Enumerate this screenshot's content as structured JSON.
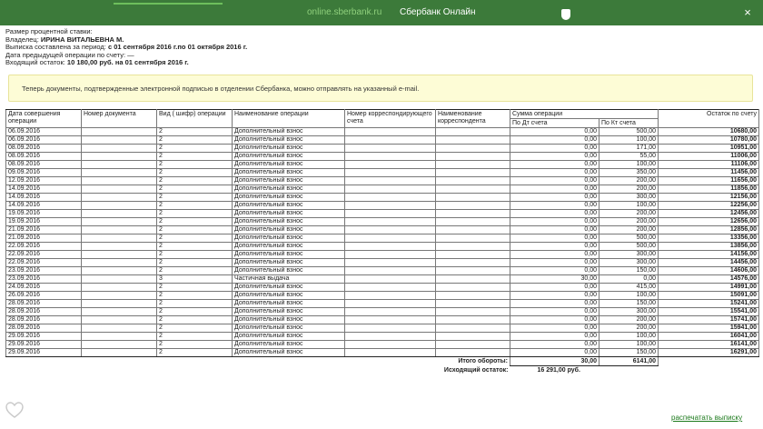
{
  "window": {
    "url": "online.sberbank.ru",
    "title": "Сбербанк Онлайн",
    "close_glyph": "×"
  },
  "info": {
    "rate_label": "Размер процентной ставки:",
    "owner_label": "Владелец:",
    "owner_value": "ИРИНА ВИТАЛЬЕВНА М.",
    "period_label": "Выписка составлена за период:",
    "period_value": "с 01 сентября 2016 г.по 01 октября 2016 г.",
    "prev_op_label": "Дата предыдущей операции по счету:",
    "prev_op_value": "—",
    "balance_label": "Входящий остаток:",
    "balance_value": "10 180,00 руб. на 01 сентября 2016 г."
  },
  "notice": "Теперь документы, подтвержденные электронной подписью в отделении Сбербанка, можно отправлять на указанный e-mail.",
  "table": {
    "headers": {
      "date": "Дата совершения операции",
      "doc": "Номер документа",
      "code": "Вид ( шифр) операции",
      "name": "Наименование операции",
      "corr_acc": "Номер корреспондирующего счета",
      "corr_name": "Наименование корреспондента",
      "amount": "Сумма операции",
      "debit": "По Дт счета",
      "credit": "По Кт счета",
      "balance": "Остаток по счету"
    },
    "rows": [
      [
        "06.09.2016",
        "",
        "2",
        "Дополнительный взнос",
        "",
        "",
        "0,00",
        "500,00",
        "10680,00"
      ],
      [
        "06.09.2016",
        "",
        "2",
        "Дополнительный взнос",
        "",
        "",
        "0,00",
        "100,00",
        "10780,00"
      ],
      [
        "08.09.2016",
        "",
        "2",
        "Дополнительный взнос",
        "",
        "",
        "0,00",
        "171,00",
        "10951,00"
      ],
      [
        "08.09.2016",
        "",
        "2",
        "Дополнительный взнос",
        "",
        "",
        "0,00",
        "55,00",
        "11006,00"
      ],
      [
        "08.09.2016",
        "",
        "2",
        "Дополнительный взнос",
        "",
        "",
        "0,00",
        "100,00",
        "11106,00"
      ],
      [
        "09.09.2016",
        "",
        "2",
        "Дополнительный взнос",
        "",
        "",
        "0,00",
        "350,00",
        "11456,00"
      ],
      [
        "12.09.2016",
        "",
        "2",
        "Дополнительный взнос",
        "",
        "",
        "0,00",
        "200,00",
        "11656,00"
      ],
      [
        "14.09.2016",
        "",
        "2",
        "Дополнительный взнос",
        "",
        "",
        "0,00",
        "200,00",
        "11856,00"
      ],
      [
        "14.09.2016",
        "",
        "2",
        "Дополнительный взнос",
        "",
        "",
        "0,00",
        "300,00",
        "12156,00"
      ],
      [
        "14.09.2016",
        "",
        "2",
        "Дополнительный взнос",
        "",
        "",
        "0,00",
        "100,00",
        "12256,00"
      ],
      [
        "19.09.2016",
        "",
        "2",
        "Дополнительный взнос",
        "",
        "",
        "0,00",
        "200,00",
        "12456,00"
      ],
      [
        "19.09.2016",
        "",
        "2",
        "Дополнительный взнос",
        "",
        "",
        "0,00",
        "200,00",
        "12656,00"
      ],
      [
        "21.09.2016",
        "",
        "2",
        "Дополнительный взнос",
        "",
        "",
        "0,00",
        "200,00",
        "12856,00"
      ],
      [
        "21.09.2016",
        "",
        "2",
        "Дополнительный взнос",
        "",
        "",
        "0,00",
        "500,00",
        "13356,00"
      ],
      [
        "22.09.2016",
        "",
        "2",
        "Дополнительный взнос",
        "",
        "",
        "0,00",
        "500,00",
        "13856,00"
      ],
      [
        "22.09.2016",
        "",
        "2",
        "Дополнительный взнос",
        "",
        "",
        "0,00",
        "300,00",
        "14156,00"
      ],
      [
        "22.09.2016",
        "",
        "2",
        "Дополнительный взнос",
        "",
        "",
        "0,00",
        "300,00",
        "14456,00"
      ],
      [
        "23.09.2016",
        "",
        "2",
        "Дополнительный взнос",
        "",
        "",
        "0,00",
        "150,00",
        "14606,00"
      ],
      [
        "23.09.2016",
        "",
        "3",
        "Частичная выдача",
        "",
        "",
        "30,00",
        "0,00",
        "14576,00"
      ],
      [
        "24.09.2016",
        "",
        "2",
        "Дополнительный взнос",
        "",
        "",
        "0,00",
        "415,00",
        "14991,00"
      ],
      [
        "26.09.2016",
        "",
        "2",
        "Дополнительный взнос",
        "",
        "",
        "0,00",
        "100,00",
        "15091,00"
      ],
      [
        "28.09.2016",
        "",
        "2",
        "Дополнительный взнос",
        "",
        "",
        "0,00",
        "150,00",
        "15241,00"
      ],
      [
        "28.09.2016",
        "",
        "2",
        "Дополнительный взнос",
        "",
        "",
        "0,00",
        "300,00",
        "15541,00"
      ],
      [
        "28.09.2016",
        "",
        "2",
        "Дополнительный взнос",
        "",
        "",
        "0,00",
        "200,00",
        "15741,00"
      ],
      [
        "28.09.2016",
        "",
        "2",
        "Дополнительный взнос",
        "",
        "",
        "0,00",
        "200,00",
        "15941,00"
      ],
      [
        "29.09.2016",
        "",
        "2",
        "Дополнительный взнос",
        "",
        "",
        "0,00",
        "100,00",
        "16041,00"
      ],
      [
        "29.09.2016",
        "",
        "2",
        "Дополнительный взнос",
        "",
        "",
        "0,00",
        "100,00",
        "16141,00"
      ],
      [
        "29.09.2016",
        "",
        "2",
        "Дополнительный взнос",
        "",
        "",
        "0,00",
        "150,00",
        "16291,00"
      ]
    ],
    "totals_label": "Итого обороты:",
    "totals_debit": "30,00",
    "totals_credit": "6141,00",
    "closing_label": "Исходящий остаток:",
    "closing_value": "16 291,00 руб."
  },
  "print_link": "распечатать выписку",
  "colors": {
    "titlebar": "#3c7a3a",
    "link": "#1d7a1d",
    "notice_bg": "#fdfcd6"
  }
}
